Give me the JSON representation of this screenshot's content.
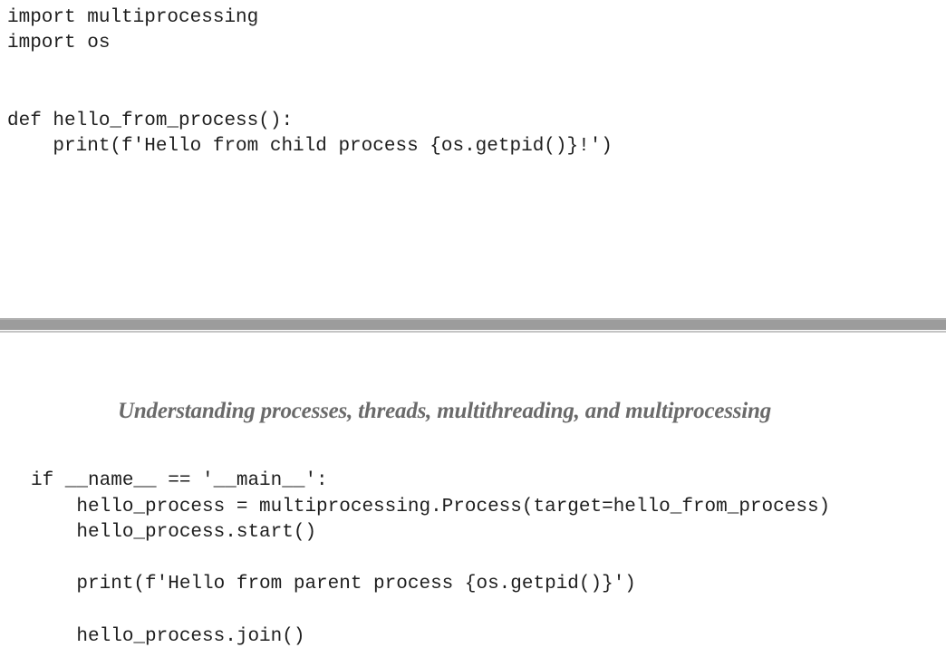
{
  "code_block_top": {
    "lines": [
      "import multiprocessing",
      "import os",
      "def hello_from_process():",
      "    print(f'Hello from child process {os.getpid()}!')"
    ]
  },
  "page_header": {
    "title": "Understanding processes, threads, multithreading, and multiprocessing"
  },
  "code_block_bottom": {
    "lines": [
      "if __name__ == '__main__':",
      "    hello_process = multiprocessing.Process(target=hello_from_process)",
      "    hello_process.start()",
      "    print(f'Hello from parent process {os.getpid()}')",
      "    hello_process.join()"
    ]
  }
}
